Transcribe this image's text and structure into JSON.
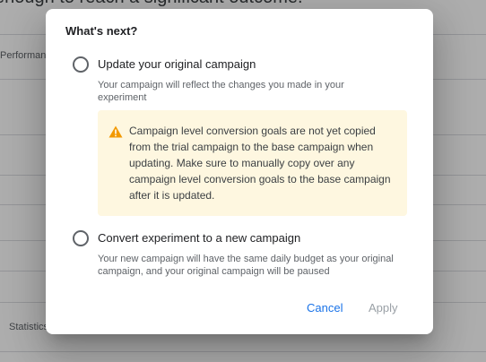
{
  "background": {
    "heading": "enough to reach a significant outcome.",
    "tab_label": "Performance",
    "footer_label": "Statistics"
  },
  "dialog": {
    "title": "What's next?",
    "options": [
      {
        "label": "Update your original campaign",
        "description": "Your campaign will reflect the changes you made in your experiment",
        "selected": false
      },
      {
        "label": "Convert experiment to a new campaign",
        "description": "Your new campaign will have the same daily budget as your original campaign, and your original campaign will be paused",
        "selected": false
      }
    ],
    "warning": {
      "icon": "warning-icon",
      "color": "#f29900",
      "text": "Campaign level conversion goals are not yet copied from the trial campaign to the base campaign when updating. Make sure to manually copy over any campaign level conversion goals to the base campaign after it is updated."
    },
    "buttons": {
      "cancel": "Cancel",
      "apply": "Apply"
    }
  },
  "colors": {
    "accent": "#1a73e8",
    "disabled": "#9aa0a6",
    "warning_bg": "#fef7e0"
  }
}
